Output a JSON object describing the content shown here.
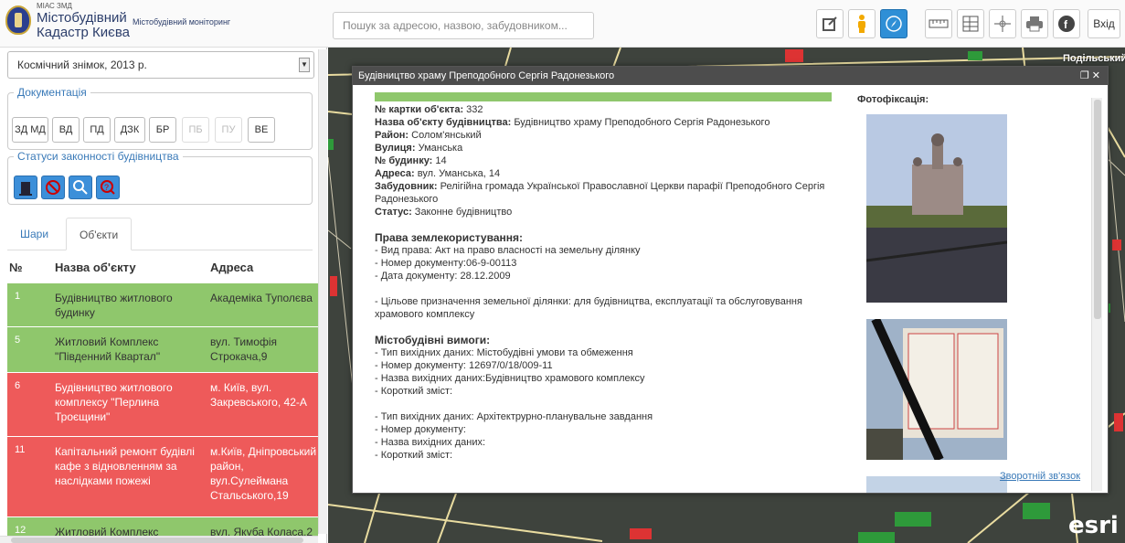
{
  "header": {
    "brand_small": "МІАС ЗМД",
    "brand_line1": "Містобудівний",
    "brand_line2": "Кадастр Києва",
    "brand_sub": "Містобудівний моніторинг",
    "search_placeholder": "Пошук за адресою, назвою, забудовником...",
    "login_label": "Вхід",
    "tools": [
      "edit-icon",
      "pegman-icon",
      "compass-icon",
      "ruler-icon",
      "layers-icon",
      "crosshair-icon",
      "print-icon",
      "facebook-icon"
    ]
  },
  "sidebar": {
    "basemap_select": "Космічний знімок, 2013 р.",
    "documentation_legend": "Документація",
    "doc_buttons": [
      {
        "label": "ЗД МД",
        "disabled": false
      },
      {
        "label": "ВД",
        "disabled": false
      },
      {
        "label": "ПД",
        "disabled": false
      },
      {
        "label": "ДЗК",
        "disabled": false
      },
      {
        "label": "БР",
        "disabled": false
      },
      {
        "label": "ПБ",
        "disabled": true
      },
      {
        "label": "ПУ",
        "disabled": true
      },
      {
        "label": "ВЕ",
        "disabled": false
      }
    ],
    "statuses_legend": "Статуси законності будівництва",
    "status_icons": [
      "legal-building-icon",
      "illegal-building-icon",
      "inspection-icon",
      "unknown-status-icon"
    ],
    "tabs": [
      {
        "label": "Шари"
      },
      {
        "label": "Об'єкти"
      }
    ],
    "table": {
      "headers": [
        "№",
        "Назва об'єкту",
        "Адреса"
      ],
      "rows": [
        {
          "num": "1",
          "name": "Будівництво житлового будинку",
          "address": "Академіка Туполєва",
          "status": "green"
        },
        {
          "num": "5",
          "name": "Житловий Комплекс \"Південний Квартал\"",
          "address": "вул. Тимофія Строкача,9",
          "status": "green"
        },
        {
          "num": "6",
          "name": "Будівництво житлового комплексу \"Перлина Троєщини\"",
          "address": "м. Київ, вул. Закревського, 42-А",
          "status": "red"
        },
        {
          "num": "11",
          "name": "Капітальний ремонт будівлі кафе з відновленням за наслідками пожежі",
          "address": "м.Київ, Дніпровський район, вул.Сулейманa Стальського,19",
          "status": "red"
        },
        {
          "num": "12",
          "name": "Житловий Комплекс",
          "address": "вул. Якуба Коласа,2",
          "status": "green"
        }
      ]
    }
  },
  "map": {
    "district_label": "Подільський",
    "esri_logo": "esri"
  },
  "popup": {
    "title": "Будівництво храму Преподобного Сергія Радонезького",
    "card_number_label": "№ картки об'єкта:",
    "card_number": "332",
    "object_name_label": "Назва об'єкту будівництва:",
    "object_name": "Будівництво храму Преподобного Сергія Радонезького",
    "district_label": "Район:",
    "district": "Солом'янський",
    "street_label": "Вулиця:",
    "street": "Уманська",
    "house_label": "№ будинку:",
    "house": "14",
    "address_label": "Адреса:",
    "address": "вул. Уманська, 14",
    "developer_label": "Забудовник:",
    "developer": "Релігійна громада Української Православної Церкви парафії Преподобного Сергія Радонезького",
    "status_label": "Статус:",
    "status": "Законне будівництво",
    "land_rights_title": "Права землекористування:",
    "land_rights": [
      "- Вид права: Акт на право власності на земельну ділянку",
      "- Номер документу:06-9-00113",
      "- Дата документу:  28.12.2009"
    ],
    "purpose": "- Цільове призначення земельної ділянки: для будівництва, експлуатації та обслуговування храмового комплексу",
    "requirements_title": "Містобудівні вимоги:",
    "requirements_1": [
      "- Тип вихідних даних: Містобудівні умови та обмеження",
      "- Номер документу:       12697/0/18/009-11",
      "- Назва вихідних даних:Будівництво храмового комплексу",
      "- Короткий зміст:"
    ],
    "requirements_2": [
      "- Тип вихідних даних: Архітектрурно-планувальне завдання",
      "- Номер документу:",
      "- Назва вихідних даних:",
      "- Короткий зміст:"
    ],
    "photo_title": "Фотофіксація:",
    "feedback_link": "Зворотній зв'язок",
    "status_color": "#8fc76c"
  }
}
